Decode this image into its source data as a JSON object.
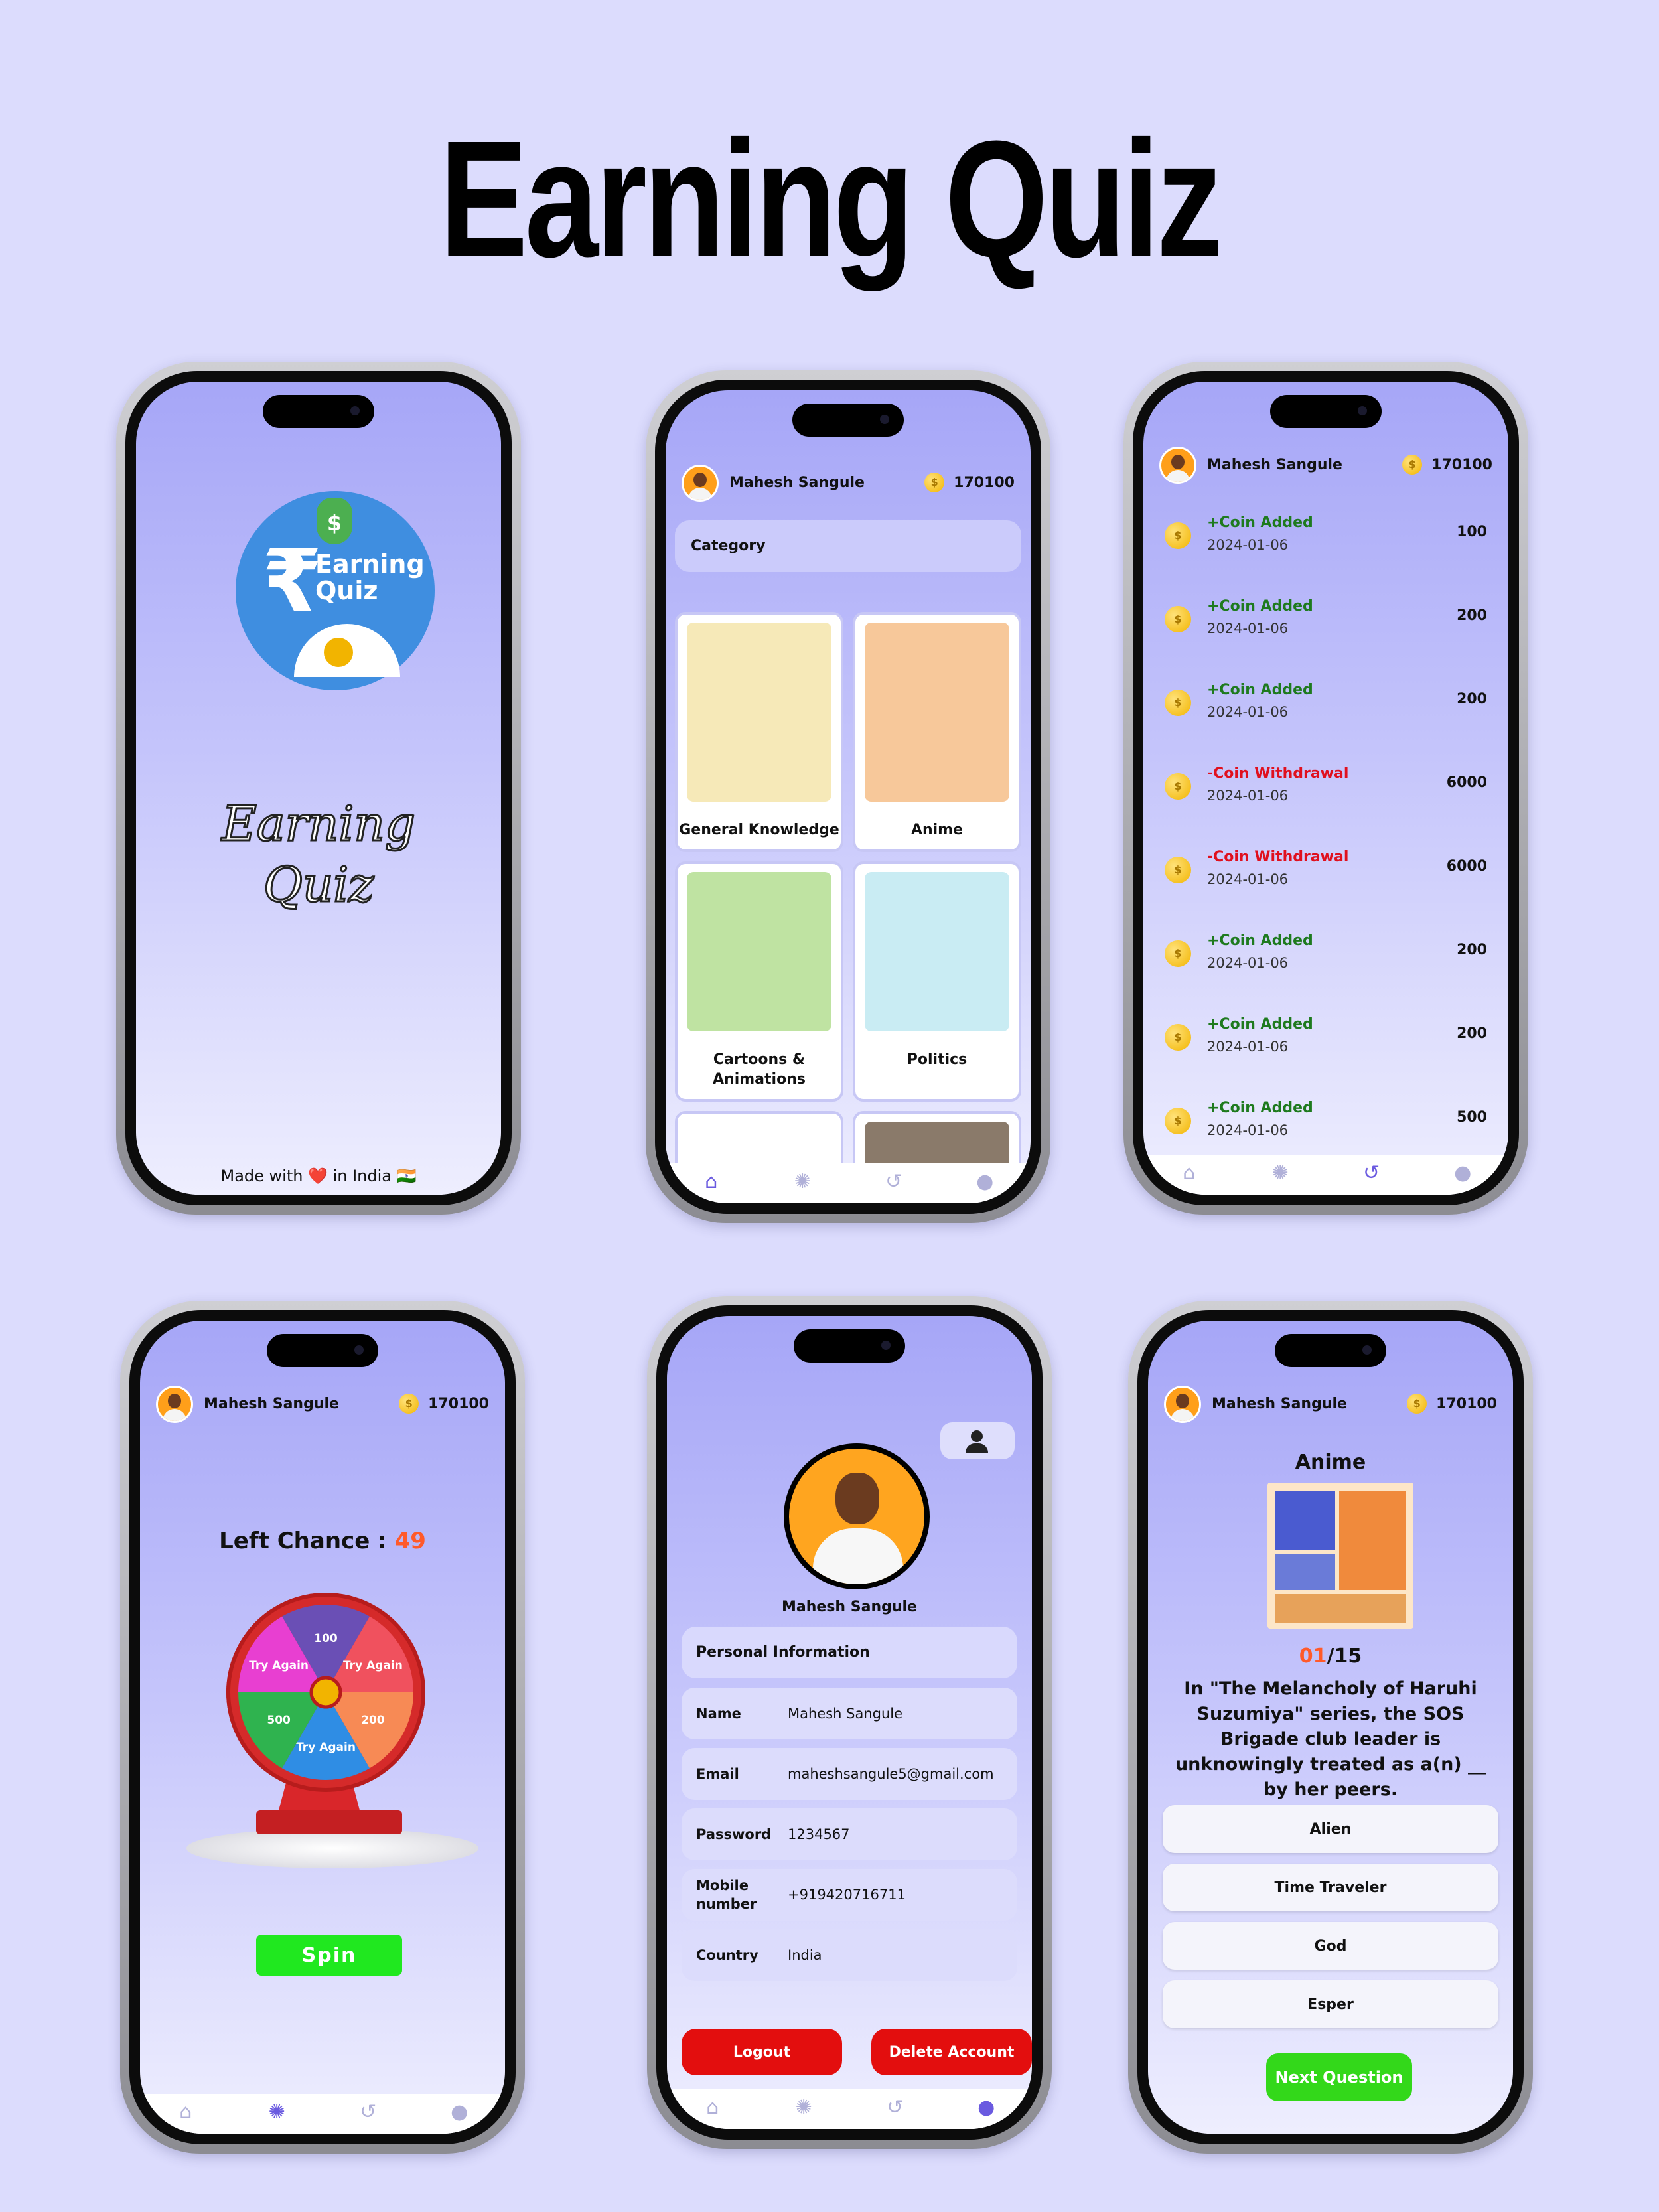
{
  "title": "Earning Quiz",
  "user": {
    "name": "Mahesh Sangule",
    "coins": "170100"
  },
  "splash": {
    "logo_line1": "Earning",
    "logo_line2": "Quiz",
    "name_line1": "Earning",
    "name_line2": "Quiz",
    "footer": "Made with ❤️ in India 🇮🇳"
  },
  "category": {
    "header": "Category",
    "items": [
      {
        "label": "General Knowledge",
        "color": "#f6e9b8"
      },
      {
        "label": "Anime",
        "color": "#f7c89a"
      },
      {
        "label": "Cartoons & Animations",
        "color": "#bfe3a2"
      },
      {
        "label": "Politics",
        "color": "#c9ecf3"
      }
    ]
  },
  "history": [
    {
      "title": "+Coin Added",
      "date": "2024-01-06",
      "amount": "100",
      "kind": "plus"
    },
    {
      "title": "+Coin Added",
      "date": "2024-01-06",
      "amount": "200",
      "kind": "plus"
    },
    {
      "title": "+Coin Added",
      "date": "2024-01-06",
      "amount": "200",
      "kind": "plus"
    },
    {
      "title": "-Coin Withdrawal",
      "date": "2024-01-06",
      "amount": "6000",
      "kind": "minus"
    },
    {
      "title": "-Coin Withdrawal",
      "date": "2024-01-06",
      "amount": "6000",
      "kind": "minus"
    },
    {
      "title": "+Coin Added",
      "date": "2024-01-06",
      "amount": "200",
      "kind": "plus"
    },
    {
      "title": "+Coin Added",
      "date": "2024-01-06",
      "amount": "200",
      "kind": "plus"
    },
    {
      "title": "+Coin Added",
      "date": "2024-01-06",
      "amount": "500",
      "kind": "plus"
    }
  ],
  "spin": {
    "label": "Left Chance :",
    "chances": "49",
    "button": "Spin",
    "segments": [
      {
        "label": "100",
        "color": "#6a4fb5"
      },
      {
        "label": "Try Again",
        "color": "#f0515e"
      },
      {
        "label": "200",
        "color": "#f78a55"
      },
      {
        "label": "Try Again",
        "color": "#2f8de4"
      },
      {
        "label": "500",
        "color": "#2fb34f"
      },
      {
        "label": "Try Again",
        "color": "#e83fd1"
      }
    ]
  },
  "profile": {
    "name": "Mahesh Sangule",
    "section": "Personal Information",
    "fields": [
      {
        "label": "Name",
        "value": "Mahesh Sangule"
      },
      {
        "label": "Email",
        "value": "maheshsangule5@gmail.com"
      },
      {
        "label": "Password",
        "value": "1234567"
      },
      {
        "label": "Mobile number",
        "value": "+919420716711"
      },
      {
        "label": "Country",
        "value": "India"
      }
    ],
    "logout": "Logout",
    "delete": "Delete Account"
  },
  "quiz": {
    "category": "Anime",
    "current": "01",
    "total": "/15",
    "question": "In \"The Melancholy of Haruhi Suzumiya\" series, the SOS Brigade club leader is unknowingly treated as a(n) __ by her peers.",
    "options": [
      "Alien",
      "Time Traveler",
      "God",
      "Esper"
    ],
    "next": "Next Question"
  }
}
